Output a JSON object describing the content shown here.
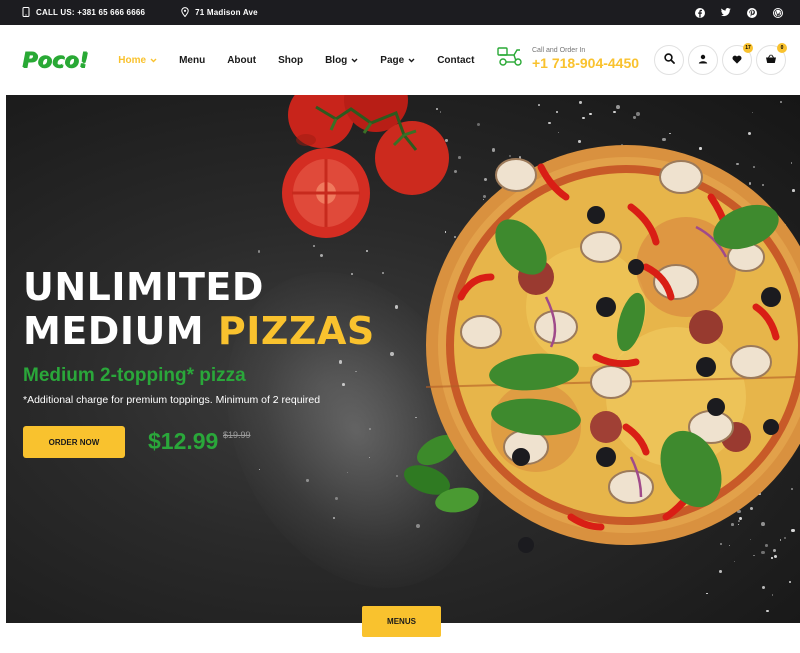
{
  "topbar": {
    "call_text": "CALL US: +381 65 666 6666",
    "address_text": "71 Madison Ave",
    "socials": [
      "facebook-icon",
      "twitter-icon",
      "pinterest-icon",
      "wordpress-icon"
    ]
  },
  "header": {
    "logo": "Poco!",
    "nav": [
      {
        "label": "Home",
        "active": true,
        "dropdown": true
      },
      {
        "label": "Menu",
        "active": false,
        "dropdown": false
      },
      {
        "label": "About",
        "active": false,
        "dropdown": false
      },
      {
        "label": "Shop",
        "active": false,
        "dropdown": false
      },
      {
        "label": "Blog",
        "active": false,
        "dropdown": true
      },
      {
        "label": "Page",
        "active": false,
        "dropdown": true
      },
      {
        "label": "Contact",
        "active": false,
        "dropdown": false
      }
    ],
    "call_label": "Call and Order In",
    "phone": "+1 718-904-4450",
    "wishlist_count": "17",
    "cart_count": "0"
  },
  "hero": {
    "title_line1": "UNLIMITED",
    "title_line2_a": "MEDIUM ",
    "title_line2_b": "PIZZAS",
    "subtitle": "Medium 2-topping* pizza",
    "note": "*Additional charge for premium toppings. Minimum of 2 required",
    "order_button": "ORDER NOW",
    "price": "$12.99",
    "old_price": "$19.99"
  },
  "menus_button": "MENUS",
  "colors": {
    "accent_yellow": "#f9c22e",
    "brand_green": "#29a935",
    "dark": "#1c1c20"
  }
}
